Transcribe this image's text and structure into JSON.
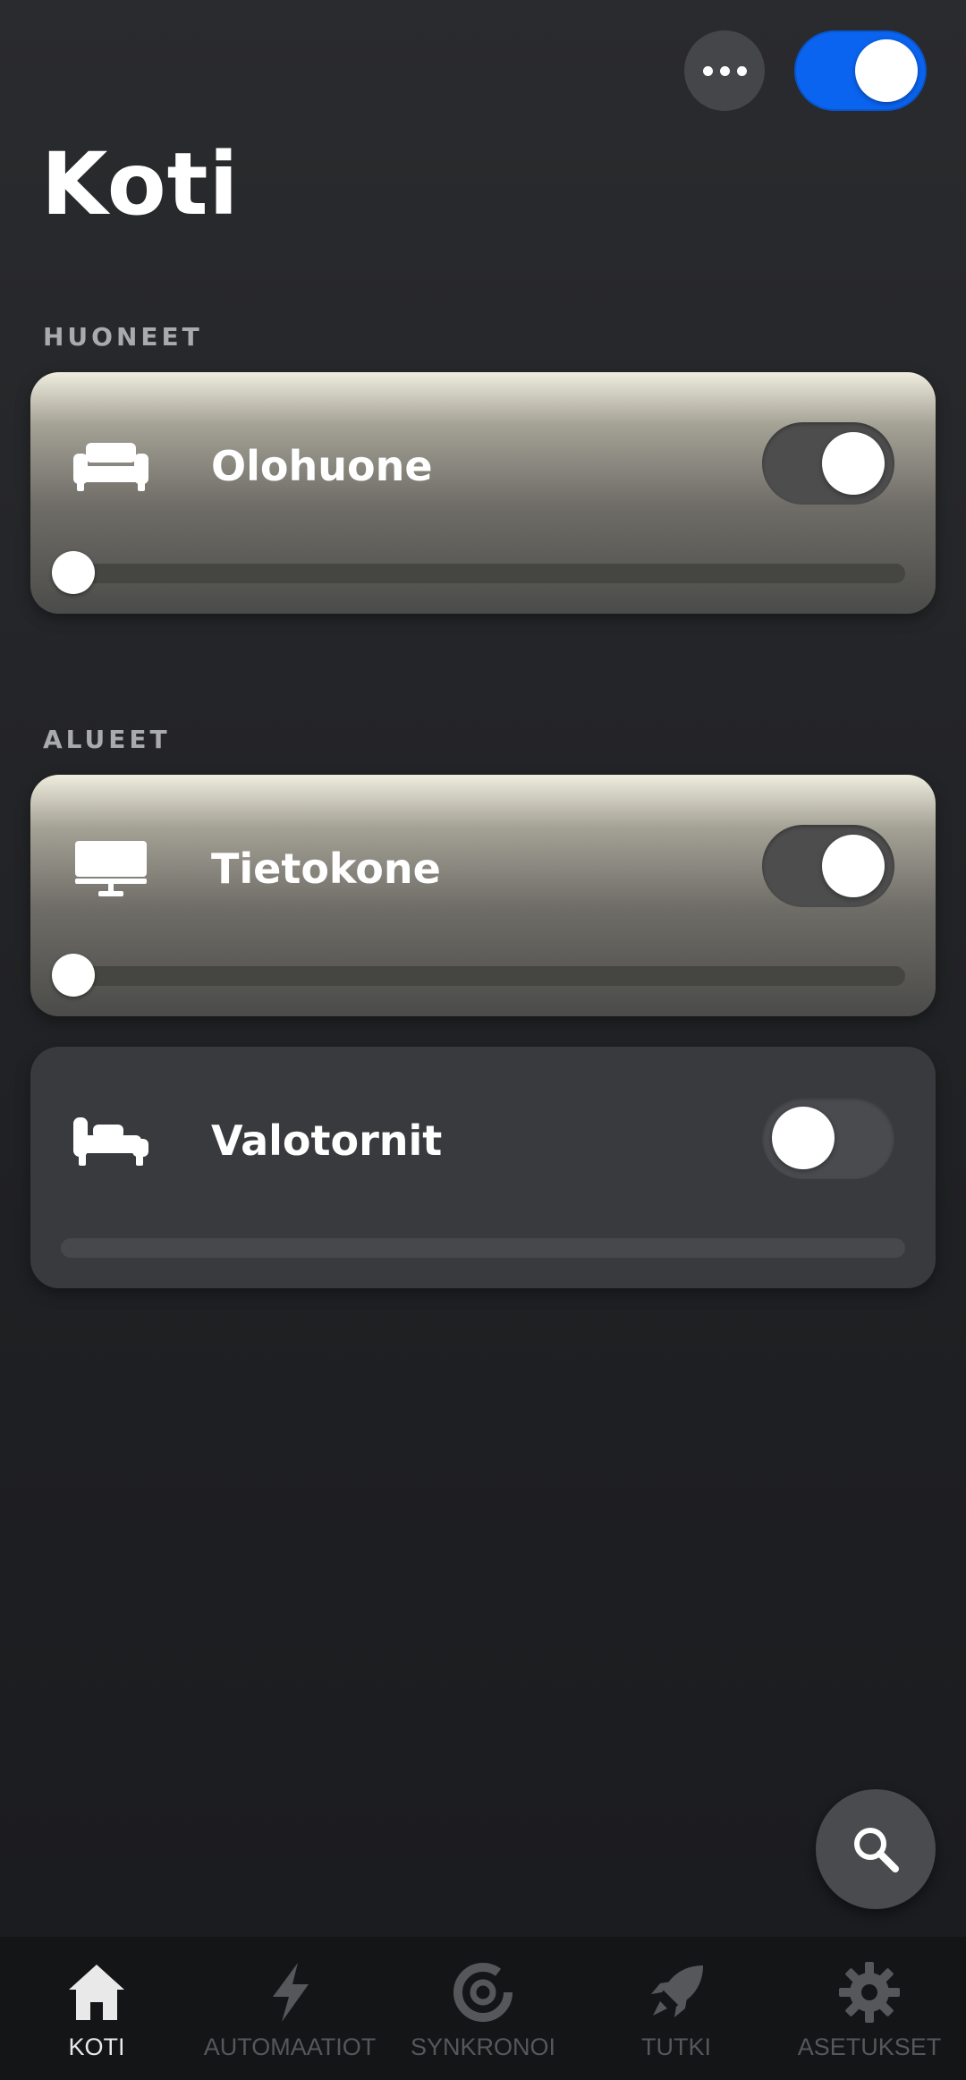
{
  "header": {
    "title": "Koti"
  },
  "sections": [
    {
      "label": "HUONEET",
      "items": [
        {
          "name": "Olohuone",
          "icon": "sofa-icon",
          "on": true,
          "brightness": 0.0
        }
      ]
    },
    {
      "label": "ALUEET",
      "items": [
        {
          "name": "Tietokone",
          "icon": "monitor-icon",
          "on": true,
          "brightness": 0.0
        },
        {
          "name": "Valotornit",
          "icon": "chaise-icon",
          "on": false,
          "brightness": 0.0
        }
      ]
    }
  ],
  "nav": [
    {
      "label": "KOTI",
      "icon": "home-icon",
      "active": true
    },
    {
      "label": "AUTOMAATIOT",
      "icon": "bolt-icon",
      "active": false
    },
    {
      "label": "SYNKRONOI",
      "icon": "sync-icon",
      "active": false
    },
    {
      "label": "TUTKI",
      "icon": "rocket-icon",
      "active": false
    },
    {
      "label": "ASETUKSET",
      "icon": "gear-icon",
      "active": false
    }
  ],
  "colors": {
    "accent": "#0a64f0",
    "navActive": "#e9e9ea",
    "navInactive": "#56575b"
  }
}
